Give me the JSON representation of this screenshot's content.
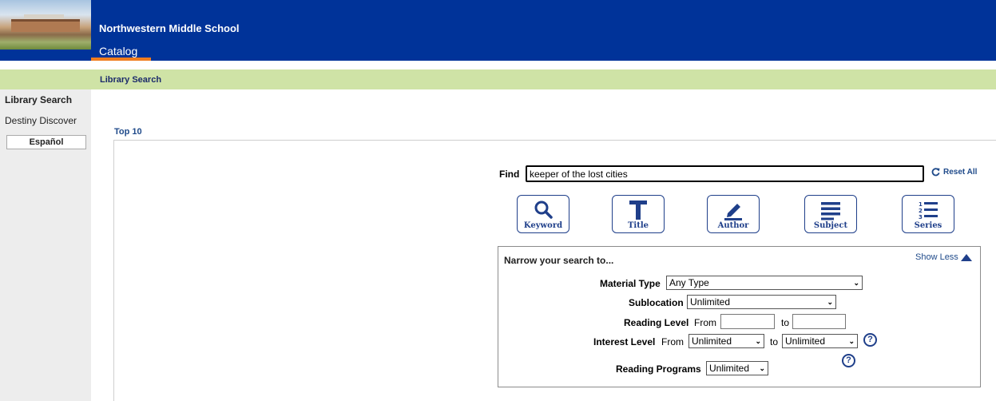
{
  "header": {
    "school_name": "Northwestern Middle School",
    "tab": "Catalog"
  },
  "subbar": {
    "label": "Library Search"
  },
  "leftnav": {
    "items": [
      "Library Search",
      "Destiny Discover"
    ],
    "language_button": "Español"
  },
  "top10": "Top 10",
  "search": {
    "find_label": "Find",
    "query": "keeper of the lost cities",
    "reset_label": "Reset All",
    "buttons": [
      "Keyword",
      "Title",
      "Author",
      "Subject",
      "Series"
    ]
  },
  "narrow": {
    "title": "Narrow your search to...",
    "toggle": "Show Less",
    "material_type_label": "Material Type",
    "material_type_value": "Any Type",
    "sublocation_label": "Sublocation",
    "sublocation_value": "Unlimited",
    "reading_level_label": "Reading Level",
    "from": "From",
    "to": "to",
    "interest_level_label": "Interest Level",
    "interest_from_value": "Unlimited",
    "interest_to_value": "Unlimited",
    "reading_programs_label": "Reading Programs",
    "reading_programs_value": "Unlimited",
    "help_glyph": "?"
  },
  "colors": {
    "header": "#003399",
    "subbar": "#cfe3a6",
    "accent": "#f07d1e",
    "link": "#1f4a8a"
  }
}
